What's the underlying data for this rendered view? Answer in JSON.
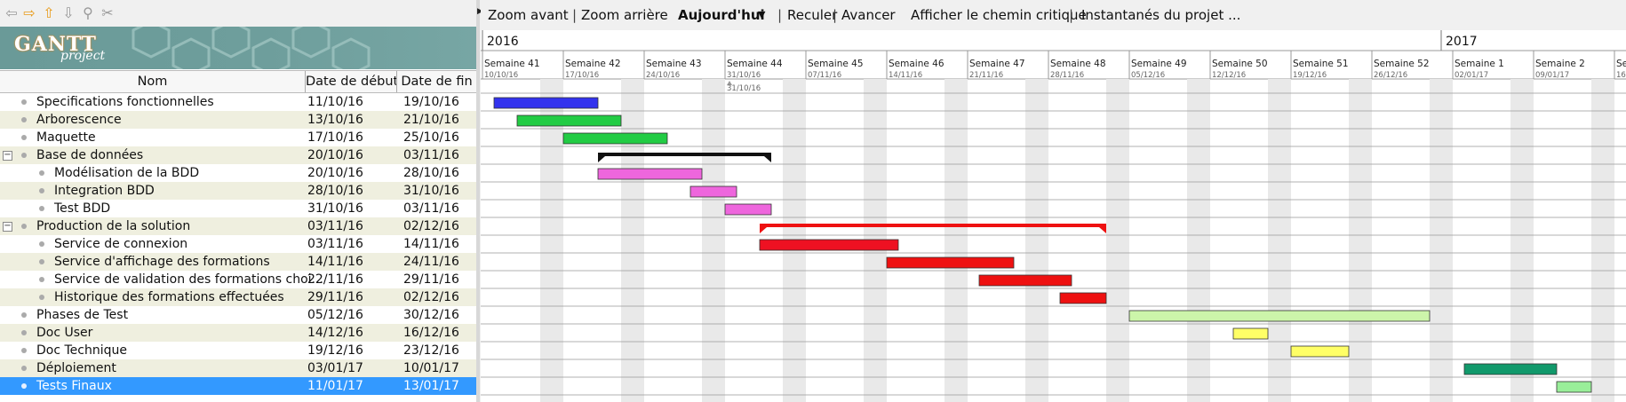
{
  "left_toolbar": {
    "icons": [
      "back-arrow-icon",
      "forward-arrow-icon",
      "up-arrow-icon",
      "down-arrow-icon",
      "link-icon",
      "unlink-icon"
    ]
  },
  "logo": {
    "title": "GANTT",
    "subtitle": "project"
  },
  "table": {
    "columns": [
      "Nom",
      "Date de début",
      "Date de fin"
    ],
    "rows": [
      {
        "name": "Specifications fonctionnelles",
        "start": "11/10/16",
        "end": "19/10/16",
        "level": 0,
        "toggle": ""
      },
      {
        "name": "Arborescence",
        "start": "13/10/16",
        "end": "21/10/16",
        "level": 0,
        "toggle": ""
      },
      {
        "name": "Maquette",
        "start": "17/10/16",
        "end": "25/10/16",
        "level": 0,
        "toggle": ""
      },
      {
        "name": "Base de données",
        "start": "20/10/16",
        "end": "03/11/16",
        "level": 0,
        "toggle": "−"
      },
      {
        "name": "Modélisation de la BDD",
        "start": "20/10/16",
        "end": "28/10/16",
        "level": 1,
        "toggle": ""
      },
      {
        "name": "Integration BDD",
        "start": "28/10/16",
        "end": "31/10/16",
        "level": 1,
        "toggle": ""
      },
      {
        "name": "Test BDD",
        "start": "31/10/16",
        "end": "03/11/16",
        "level": 1,
        "toggle": ""
      },
      {
        "name": "Production de la solution",
        "start": "03/11/16",
        "end": "02/12/16",
        "level": 0,
        "toggle": "−"
      },
      {
        "name": "Service de connexion",
        "start": "03/11/16",
        "end": "14/11/16",
        "level": 1,
        "toggle": ""
      },
      {
        "name": "Service d'affichage des formations",
        "start": "14/11/16",
        "end": "24/11/16",
        "level": 1,
        "toggle": ""
      },
      {
        "name": "Service de validation des formations choi...",
        "start": "22/11/16",
        "end": "29/11/16",
        "level": 1,
        "toggle": ""
      },
      {
        "name": "Historique des formations effectuées",
        "start": "29/11/16",
        "end": "02/12/16",
        "level": 1,
        "toggle": ""
      },
      {
        "name": "Phases de Test",
        "start": "05/12/16",
        "end": "30/12/16",
        "level": 0,
        "toggle": ""
      },
      {
        "name": "Doc User",
        "start": "14/12/16",
        "end": "16/12/16",
        "level": 0,
        "toggle": ""
      },
      {
        "name": "Doc Technique",
        "start": "19/12/16",
        "end": "23/12/16",
        "level": 0,
        "toggle": ""
      },
      {
        "name": "Déploiement",
        "start": "03/01/17",
        "end": "10/01/17",
        "level": 0,
        "toggle": ""
      },
      {
        "name": "Tests Finaux",
        "start": "11/01/17",
        "end": "13/01/17",
        "level": 0,
        "toggle": "",
        "selected": true
      }
    ]
  },
  "chart_toolbar": {
    "zoom_in": "Zoom avant",
    "zoom_out": "Zoom arrière",
    "today": "Aujourd'hui",
    "back": "Reculer",
    "forward": "Avancer",
    "critical_path": "Afficher le chemin critique",
    "snapshots": "Instantanés du projet ...",
    "separator": "|"
  },
  "timeline": {
    "years": [
      {
        "label": "2016",
        "day": 0
      },
      {
        "label": "2017",
        "day": 83
      }
    ],
    "weeks": [
      {
        "label": "Semaine 41",
        "date": "10/10/16"
      },
      {
        "label": "Semaine 42",
        "date": "17/10/16"
      },
      {
        "label": "Semaine 43",
        "date": "24/10/16"
      },
      {
        "label": "Semaine 44",
        "date": "31/10/16"
      },
      {
        "label": "Semaine 45",
        "date": "07/11/16"
      },
      {
        "label": "Semaine 46",
        "date": "14/11/16"
      },
      {
        "label": "Semaine 47",
        "date": "21/11/16"
      },
      {
        "label": "Semaine 48",
        "date": "28/11/16"
      },
      {
        "label": "Semaine 49",
        "date": "05/12/16"
      },
      {
        "label": "Semaine 50",
        "date": "12/12/16"
      },
      {
        "label": "Semaine 51",
        "date": "19/12/16"
      },
      {
        "label": "Semaine 52",
        "date": "26/12/16"
      },
      {
        "label": "Semaine 1",
        "date": "02/01/17"
      },
      {
        "label": "Semaine 2",
        "date": "09/01/17"
      },
      {
        "label": "Se",
        "date": "16"
      }
    ],
    "marker": {
      "label": "31/10/16",
      "day": 21
    }
  },
  "bars": [
    {
      "start": 1,
      "end": 10,
      "color": "#3333ee",
      "kind": "task"
    },
    {
      "start": 3,
      "end": 12,
      "color": "#22cc44",
      "kind": "task"
    },
    {
      "start": 7,
      "end": 16,
      "color": "#22cc44",
      "kind": "task"
    },
    {
      "start": 10,
      "end": 25,
      "color": "#111111",
      "kind": "summary"
    },
    {
      "start": 10,
      "end": 19,
      "color": "#ee66dd",
      "kind": "task"
    },
    {
      "start": 18,
      "end": 22,
      "color": "#ee66dd",
      "kind": "task"
    },
    {
      "start": 21,
      "end": 25,
      "color": "#ee66dd",
      "kind": "task"
    },
    {
      "start": 24,
      "end": 54,
      "color": "#ee1111",
      "kind": "summary"
    },
    {
      "start": 24,
      "end": 36,
      "color": "#ee1122",
      "kind": "task"
    },
    {
      "start": 35,
      "end": 46,
      "color": "#ee1111",
      "kind": "task"
    },
    {
      "start": 43,
      "end": 51,
      "color": "#ee1111",
      "kind": "task"
    },
    {
      "start": 50,
      "end": 54,
      "color": "#ee1111",
      "kind": "task"
    },
    {
      "start": 56,
      "end": 82,
      "color": "#ccf5aa",
      "kind": "task"
    },
    {
      "start": 65,
      "end": 68,
      "color": "#ffff66",
      "kind": "task"
    },
    {
      "start": 70,
      "end": 75,
      "color": "#ffff66",
      "kind": "task"
    },
    {
      "start": 85,
      "end": 93,
      "color": "#11996b",
      "kind": "task"
    },
    {
      "start": 93,
      "end": 96,
      "color": "#99ee99",
      "kind": "task"
    }
  ]
}
